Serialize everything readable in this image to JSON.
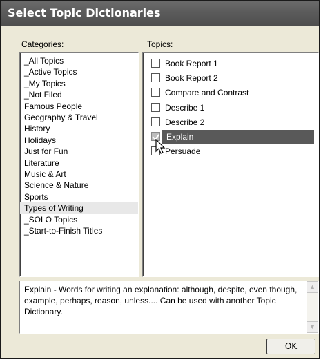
{
  "window": {
    "title": "Select Topic Dictionaries"
  },
  "categories": {
    "label": "Categories:",
    "items": [
      {
        "label": "_All Topics",
        "selected": false
      },
      {
        "label": "_Active Topics",
        "selected": false
      },
      {
        "label": "_My Topics",
        "selected": false
      },
      {
        "label": "_Not Filed",
        "selected": false
      },
      {
        "label": "Famous People",
        "selected": false
      },
      {
        "label": "Geography & Travel",
        "selected": false
      },
      {
        "label": "History",
        "selected": false
      },
      {
        "label": "Holidays",
        "selected": false
      },
      {
        "label": "Just for Fun",
        "selected": false
      },
      {
        "label": "Literature",
        "selected": false
      },
      {
        "label": "Music & Art",
        "selected": false
      },
      {
        "label": "Science & Nature",
        "selected": false
      },
      {
        "label": "Sports",
        "selected": false
      },
      {
        "label": "Types of Writing",
        "selected": true
      },
      {
        "label": "_SOLO Topics",
        "selected": false
      },
      {
        "label": "_Start-to-Finish Titles",
        "selected": false
      }
    ]
  },
  "topics": {
    "label": "Topics:",
    "items": [
      {
        "label": "Book Report 1",
        "checked": false,
        "selected": false
      },
      {
        "label": "Book Report 2",
        "checked": false,
        "selected": false
      },
      {
        "label": "Compare and Contrast",
        "checked": false,
        "selected": false
      },
      {
        "label": "Describe 1",
        "checked": false,
        "selected": false
      },
      {
        "label": "Describe 2",
        "checked": false,
        "selected": false
      },
      {
        "label": "Explain",
        "checked": true,
        "selected": true
      },
      {
        "label": "Persuade",
        "checked": false,
        "selected": false
      }
    ]
  },
  "description": {
    "text": "Explain - Words for writing an explanation: although, despite, even though, example, perhaps, reason, unless.... Can be used with another Topic Dictionary."
  },
  "buttons": {
    "ok_label": "OK"
  },
  "colors": {
    "titlebar": "#5a5a5a",
    "selection": "#595959",
    "dialog_bg": "#ece9d8"
  }
}
